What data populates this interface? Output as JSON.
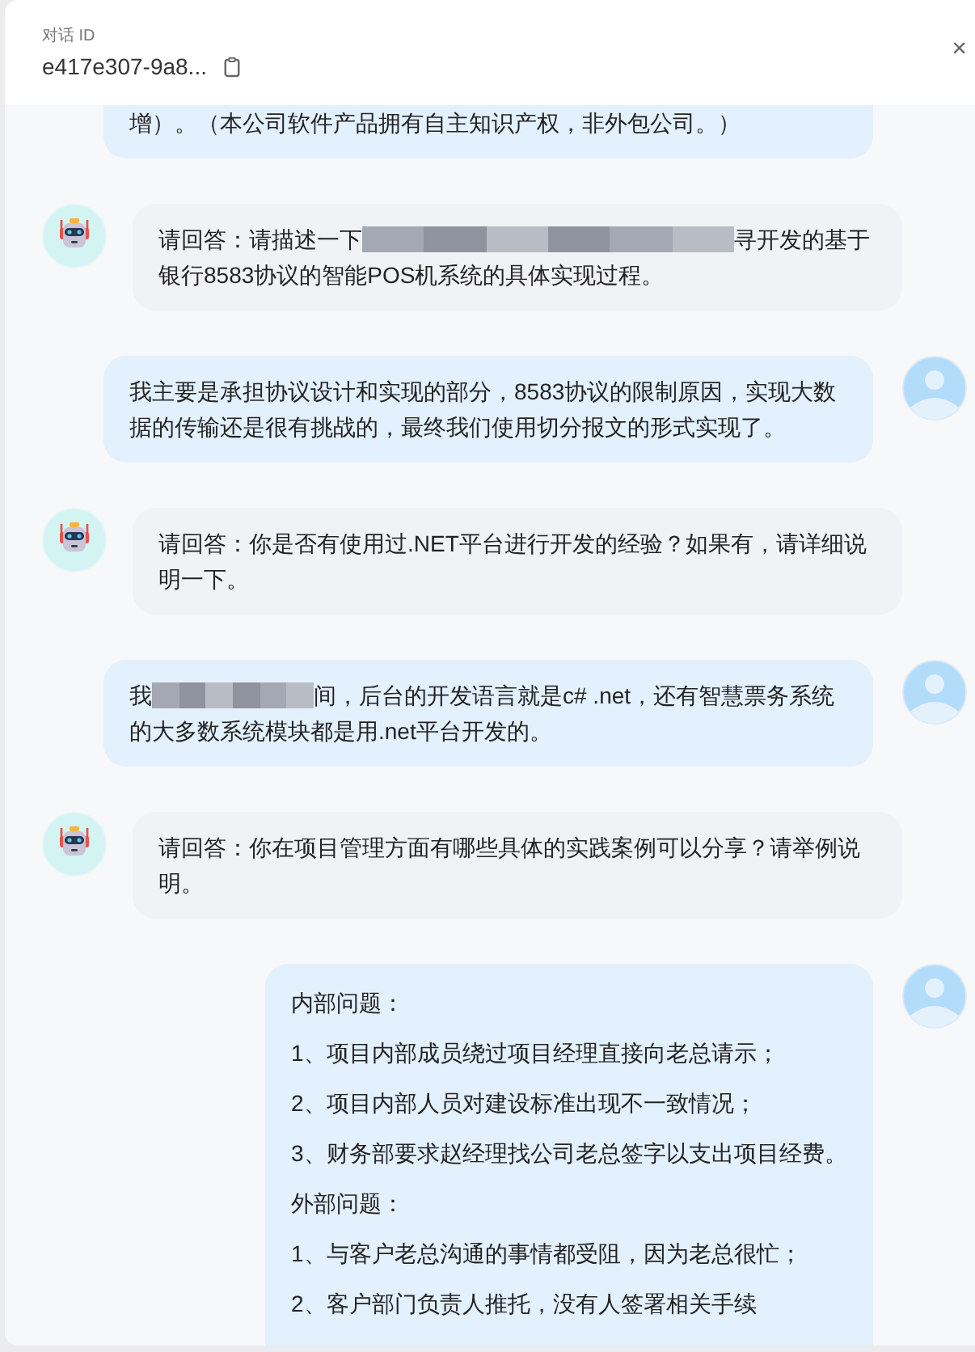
{
  "header": {
    "label": "对话 ID",
    "conversation_id": "e417e307-9a8...",
    "close": "×"
  },
  "messages": [
    {
      "kind": "user",
      "clipped": true,
      "paragraphs": [
        [
          {
            "kind": "text",
            "text": "增）。（本公司软件产品拥有自主知识产权，非外包公司。）"
          }
        ]
      ]
    },
    {
      "kind": "bot",
      "clipped": false,
      "paragraphs": [
        [
          {
            "kind": "text",
            "text": "请回答：请描述一下"
          },
          {
            "kind": "redacted_long"
          },
          {
            "kind": "text",
            "text": "寻开发的基于银行8583协议的智能POS机系统的具体实现过程。"
          }
        ]
      ]
    },
    {
      "kind": "user",
      "clipped": false,
      "paragraphs": [
        [
          {
            "kind": "text",
            "text": "我主要是承担协议设计和实现的部分，8583协议的限制原因，实现大数据的传输还是很有挑战的，最终我们使用切分报文的形式实现了。"
          }
        ]
      ]
    },
    {
      "kind": "bot",
      "clipped": false,
      "paragraphs": [
        [
          {
            "kind": "text",
            "text": "请回答：你是否有使用过.NET平台进行开发的经验？如果有，请详细说明一下。"
          }
        ]
      ]
    },
    {
      "kind": "user",
      "clipped": false,
      "paragraphs": [
        [
          {
            "kind": "text",
            "text": "我"
          },
          {
            "kind": "redacted_short"
          },
          {
            "kind": "text",
            "text": "间，后台的开发语言就是c# .net，还有智慧票务系统的大多数系统模块都是用.net平台开发的。"
          }
        ]
      ]
    },
    {
      "kind": "bot",
      "clipped": false,
      "paragraphs": [
        [
          {
            "kind": "text",
            "text": "请回答：你在项目管理方面有哪些具体的实践案例可以分享？请举例说明。"
          }
        ]
      ]
    },
    {
      "kind": "user",
      "clipped": false,
      "paragraphs": [
        [
          {
            "kind": "text",
            "text": "内部问题："
          }
        ],
        [
          {
            "kind": "text",
            "text": "1、项目内部成员绕过项目经理直接向老总请示；"
          }
        ],
        [
          {
            "kind": "text",
            "text": "2、项目内部人员对建设标准出现不一致情况；"
          }
        ],
        [
          {
            "kind": "text",
            "text": "3、财务部要求赵经理找公司老总签字以支出项目经费。"
          }
        ],
        [
          {
            "kind": "text",
            "text": "外部问题："
          }
        ],
        [
          {
            "kind": "text",
            "text": "1、与客户老总沟通的事情都受阻，因为老总很忙；"
          }
        ],
        [
          {
            "kind": "text",
            "text": "2、客户部门负责人推托，没有人签署相关手续"
          }
        ]
      ]
    }
  ]
}
